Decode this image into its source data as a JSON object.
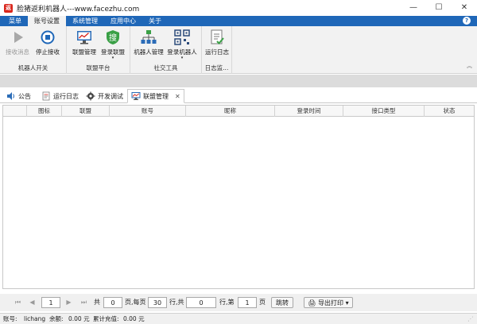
{
  "window": {
    "app_icon": "返",
    "title": "脸猪返利机器人---www.facezhu.com",
    "controls": [
      "—",
      "☐",
      "✕"
    ]
  },
  "menubar": {
    "tabs": [
      {
        "label": "菜单",
        "active": false
      },
      {
        "label": "账号设置",
        "active": true
      },
      {
        "label": "系统管理",
        "active": false
      },
      {
        "label": "应用中心",
        "active": false
      },
      {
        "label": "关于",
        "active": false
      }
    ],
    "help": "?"
  },
  "ribbon": {
    "groups": [
      {
        "label": "机器人开关",
        "buttons": [
          {
            "label": "接收消息",
            "icon": "play-icon",
            "disabled": true
          },
          {
            "label": "停止接收",
            "icon": "stop-icon",
            "disabled": false
          }
        ]
      },
      {
        "label": "联盟平台",
        "buttons": [
          {
            "label": "联盟管理",
            "icon": "monitor-chart-icon",
            "disabled": false
          },
          {
            "label": "登录联盟",
            "icon": "sou-login-icon",
            "disabled": false,
            "dropdown": "▾"
          }
        ]
      },
      {
        "label": "社交工具",
        "buttons": [
          {
            "label": "机器人管理",
            "icon": "network-icon",
            "disabled": false
          },
          {
            "label": "登录机器人",
            "icon": "qrcode-icon",
            "disabled": false,
            "dropdown": "▾"
          }
        ]
      },
      {
        "label": "日志监...",
        "buttons": [
          {
            "label": "运行日志",
            "icon": "log-icon",
            "disabled": false
          }
        ]
      }
    ],
    "collapse": "︽"
  },
  "doc_tabs": [
    {
      "label": "公告",
      "icon": "speaker-icon",
      "active": false
    },
    {
      "label": "运行日志",
      "icon": "log-icon",
      "active": false
    },
    {
      "label": "开发调试",
      "icon": "bug-icon",
      "active": false
    },
    {
      "label": "联盟管理",
      "icon": "monitor-chart-icon",
      "active": true,
      "close": "✕"
    }
  ],
  "table": {
    "columns": [
      "图标",
      "联盟",
      "账号",
      "昵称",
      "登录时间",
      "接口类型",
      "状态"
    ],
    "rows": []
  },
  "pager": {
    "nav": {
      "first": "⏮",
      "prev": "◀",
      "next": "▶",
      "last": "⏭"
    },
    "current_page": "1",
    "total_label": "共",
    "total_pages": "0",
    "per_page_label": "页,每页",
    "per_page": "30",
    "rows_label": "行,共",
    "total_rows": "0",
    "goto_label": "行,第",
    "goto_page": "1",
    "page_label": "页",
    "jump": "跳转",
    "export": "导出打印",
    "export_arrow": "▾"
  },
  "status": {
    "account_label": "账号:",
    "account": "lichang",
    "balance_label": "余额:",
    "balance": "0.00 元",
    "recharge_label": "累计充值:",
    "recharge": "0.00 元"
  },
  "colors": {
    "menubar": "#1f67b8",
    "ribbon": "#f2f2f2",
    "accent_green": "#2e9e3e",
    "accent_blue": "#1f67b8"
  }
}
